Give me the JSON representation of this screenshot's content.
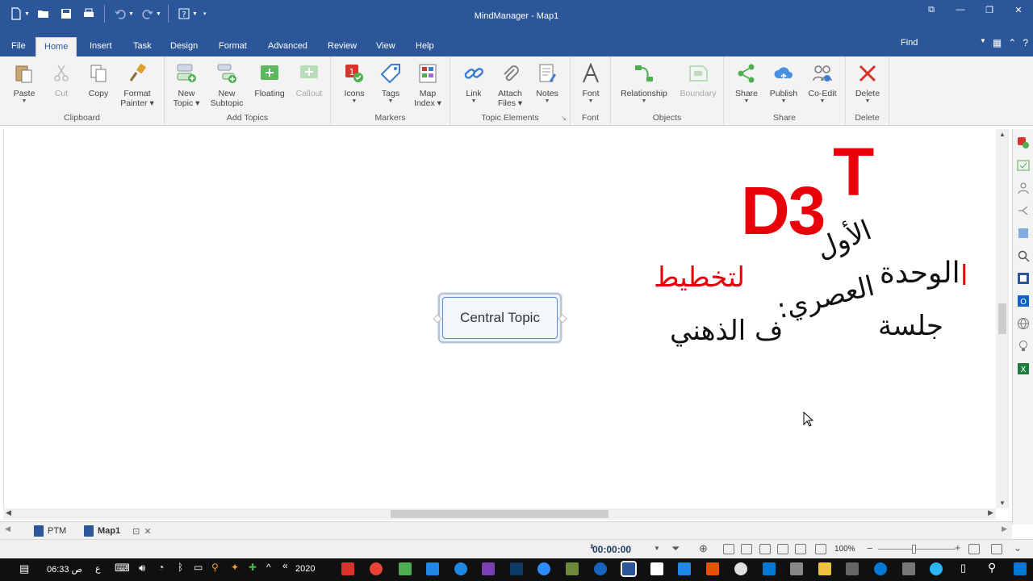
{
  "window": {
    "title": "MindManager - Map1",
    "controls": [
      "⧉",
      "—",
      "❐",
      "✕"
    ]
  },
  "tabs": [
    "File",
    "Home",
    "Insert",
    "Task",
    "Design",
    "Format",
    "Advanced",
    "Review",
    "View",
    "Help"
  ],
  "active_tab": "Home",
  "find_label": "Find",
  "ribbon": {
    "clipboard": {
      "label": "Clipboard",
      "paste": "Paste",
      "cut": "Cut",
      "copy": "Copy",
      "format_painter_1": "Format",
      "format_painter_2": "Painter"
    },
    "add_topics": {
      "label": "Add Topics",
      "new_topic_1": "New",
      "new_topic_2": "Topic",
      "new_subtopic_1": "New",
      "new_subtopic_2": "Subtopic",
      "floating": "Floating",
      "callout": "Callout"
    },
    "markers": {
      "label": "Markers",
      "icons": "Icons",
      "tags": "Tags",
      "map_index_1": "Map",
      "map_index_2": "Index"
    },
    "topic_elements": {
      "label": "Topic Elements",
      "link": "Link",
      "attach_1": "Attach",
      "attach_2": "Files",
      "notes": "Notes"
    },
    "font": {
      "label": "Font",
      "font": "Font"
    },
    "objects": {
      "label": "Objects",
      "relationship": "Relationship",
      "boundary": "Boundary"
    },
    "share": {
      "label": "Share",
      "share": "Share",
      "publish": "Publish",
      "coedit": "Co-Edit"
    },
    "delete": {
      "label": "Delete",
      "delete": "Delete"
    }
  },
  "canvas": {
    "central_topic": "Central Topic",
    "logo_main": "D3",
    "logo_sup": "T",
    "arabic": {
      "line_alawal": "الأول",
      "line_wahda": "الوحدة",
      "line_alif": "ا",
      "line_asri": "العصري:",
      "line_takhtit": "لتخطيط",
      "line_jalsa": "جلسة",
      "line_dhihni": "ف الذهني"
    }
  },
  "doc_tabs": [
    "PTM",
    "Map1"
  ],
  "status": {
    "timer": "00:00:00",
    "zoom": "100%"
  },
  "taskbar": {
    "time": "06:33 ص",
    "lang": "ع",
    "year": "2020"
  },
  "colors": {
    "title_bar": "#2b579a",
    "logo_red": "#e8000b",
    "topic_border": "#5b8bd1"
  }
}
